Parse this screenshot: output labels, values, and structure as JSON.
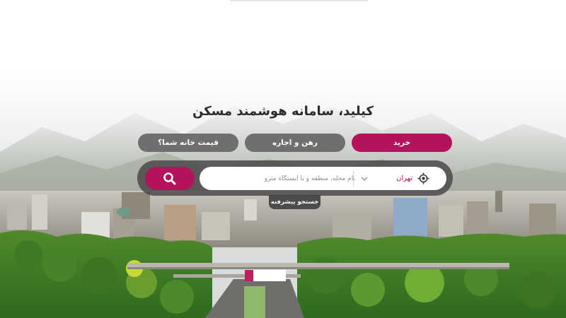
{
  "hero": {
    "title": "کیلید، سامانه هوشمند مسکن"
  },
  "tabs": [
    {
      "label": "خرید",
      "active": true
    },
    {
      "label": "رهن و اجاره",
      "active": false
    },
    {
      "label": "قیمت خانه شما؟",
      "active": false
    }
  ],
  "search": {
    "placeholder": "نام محله، منطقه و یا ایستگاه مترو",
    "value": "",
    "city": "تهران",
    "advanced_label": "جستجو پیشرفته",
    "search_icon": "search-icon",
    "location_icon": "crosshair-location-icon",
    "city_dropdown_icon": "chevron-down-icon"
  },
  "colors": {
    "accent": "#b5125c",
    "tab_idle": "#6f6f6f",
    "search_shell": "#464646",
    "city_text": "#b5125c"
  }
}
